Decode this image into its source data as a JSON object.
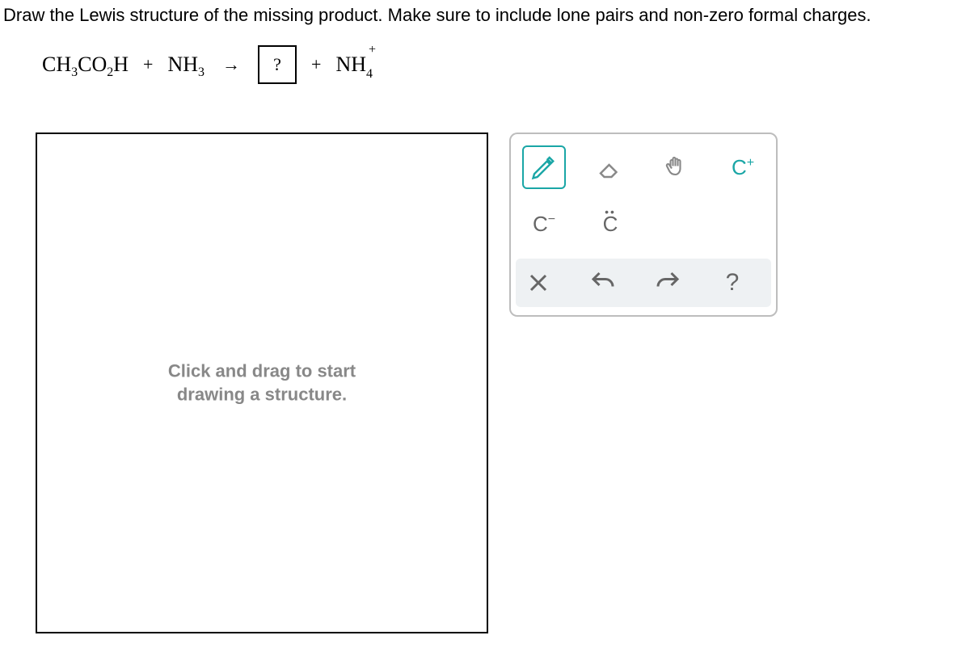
{
  "question": "Draw the Lewis structure of the missing product. Make sure to include lone pairs and non-zero formal charges.",
  "equation": {
    "reactant1_prefix": "CH",
    "reactant1_sub1": "3",
    "reactant1_mid": "CO",
    "reactant1_sub2": "2",
    "reactant1_suffix": "H",
    "plus": "+",
    "reactant2_prefix": "NH",
    "reactant2_sub": "3",
    "arrow": "→",
    "box": "?",
    "product2_prefix": "NH",
    "product2_sub": "4",
    "product2_charge": "+"
  },
  "canvas": {
    "hint_line1": "Click and drag to start",
    "hint_line2": "drawing a structure."
  },
  "tools": {
    "pencil": "pencil",
    "eraser": "eraser",
    "grab": "grab",
    "c_plus": "C",
    "c_plus_sup": "+",
    "c_minus": "C",
    "c_minus_sup": "−",
    "c_lone": "C",
    "clear": "×",
    "undo": "↶",
    "redo": "↷",
    "help": "?"
  }
}
